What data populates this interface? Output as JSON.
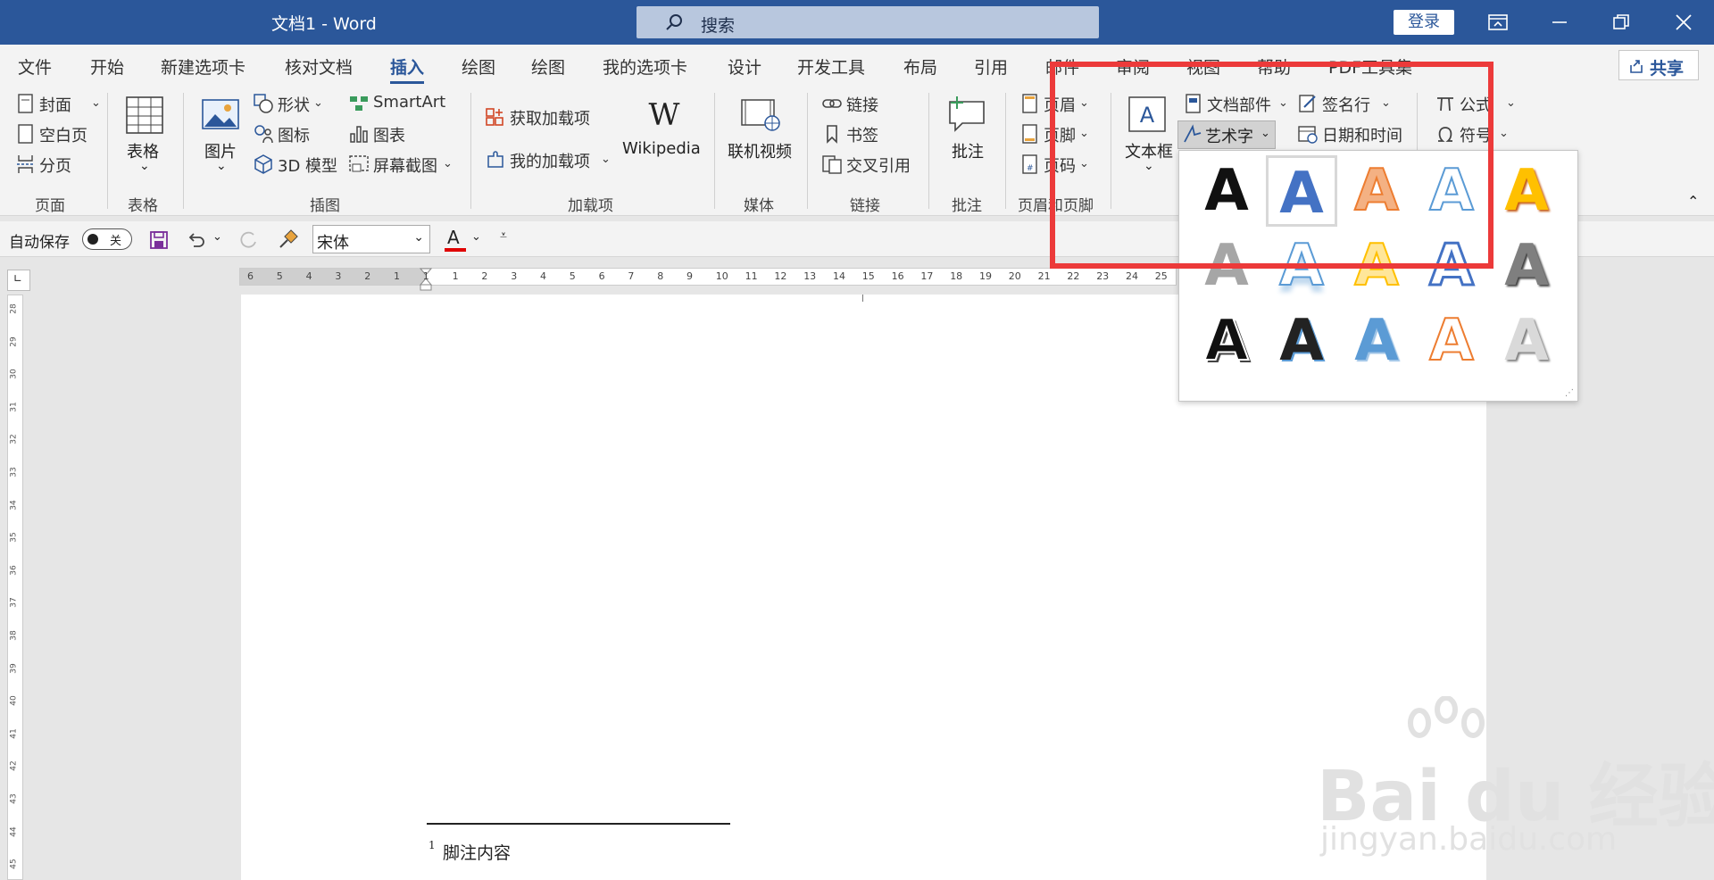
{
  "title_bar": {
    "doc_title": "文档1  -  Word",
    "search_placeholder": "搜索",
    "login_label": "登录",
    "accent_color": "#2b579a"
  },
  "tabs": [
    {
      "label": "文件"
    },
    {
      "label": "开始"
    },
    {
      "label": "新建选项卡"
    },
    {
      "label": "核对文档"
    },
    {
      "label": "插入",
      "active": true
    },
    {
      "label": "绘图"
    },
    {
      "label": "绘图"
    },
    {
      "label": "我的选项卡"
    },
    {
      "label": "设计"
    },
    {
      "label": "开发工具"
    },
    {
      "label": "布局"
    },
    {
      "label": "引用"
    },
    {
      "label": "邮件"
    },
    {
      "label": "审阅"
    },
    {
      "label": "视图"
    },
    {
      "label": "帮助"
    },
    {
      "label": "PDF工具集"
    }
  ],
  "share_label": "共享",
  "ribbon": {
    "pages": {
      "cover": "封面",
      "blank": "空白页",
      "break": "分页",
      "group": "页面"
    },
    "tables": {
      "table": "表格",
      "group": "表格"
    },
    "illustrations": {
      "picture": "图片",
      "shapes": "形状",
      "icons": "图标",
      "model3d": "3D 模型",
      "smartart": "SmartArt",
      "chart": "图表",
      "screenshot": "屏幕截图",
      "group": "插图"
    },
    "addins": {
      "get": "获取加载项",
      "my": "我的加载项",
      "wikipedia": "Wikipedia",
      "group": "加载项"
    },
    "media": {
      "video": "联机视频",
      "group": "媒体"
    },
    "links": {
      "link": "链接",
      "bookmark": "书签",
      "crossref": "交叉引用",
      "group": "链接"
    },
    "comments": {
      "comment": "批注",
      "group": "批注"
    },
    "header_footer": {
      "header": "页眉",
      "footer": "页脚",
      "page_number": "页码",
      "group": "页眉和页脚"
    },
    "text": {
      "textbox": "文本框",
      "quickparts": "文档部件",
      "wordart": "艺术字",
      "signature": "签名行",
      "datetime": "日期和时间"
    },
    "symbols": {
      "equation": "公式",
      "symbol": "符号"
    }
  },
  "qat": {
    "autosave_label": "自动保存",
    "toggle_state": "关",
    "font_name": "宋体",
    "font_color_letter": "A"
  },
  "ruler_h": [
    "6",
    "5",
    "4",
    "3",
    "2",
    "1",
    "1",
    "1",
    "2",
    "3",
    "4",
    "5",
    "6",
    "7",
    "8",
    "9",
    "10",
    "11",
    "12",
    "13",
    "14",
    "15",
    "16",
    "17",
    "18",
    "19",
    "20",
    "21",
    "22",
    "23",
    "24",
    "25"
  ],
  "ruler_v": [
    "28",
    "29",
    "30",
    "31",
    "32",
    "33",
    "34",
    "35",
    "36",
    "37",
    "38",
    "39",
    "40",
    "41",
    "42",
    "43",
    "44",
    "45"
  ],
  "wordart_gallery": [
    {
      "letter": "A",
      "style": "black-fill"
    },
    {
      "letter": "A",
      "style": "blue-fill-selected"
    },
    {
      "letter": "A",
      "style": "orange-gradient"
    },
    {
      "letter": "A",
      "style": "blue-outline"
    },
    {
      "letter": "A",
      "style": "gold-fill"
    },
    {
      "letter": "A",
      "style": "gray-fill"
    },
    {
      "letter": "A",
      "style": "blue-reflection"
    },
    {
      "letter": "A",
      "style": "gold-outline"
    },
    {
      "letter": "A",
      "style": "blue-outline-bold"
    },
    {
      "letter": "A",
      "style": "gray-dark"
    },
    {
      "letter": "A",
      "style": "black-shadow"
    },
    {
      "letter": "A",
      "style": "black-bevel"
    },
    {
      "letter": "A",
      "style": "blue-bevel"
    },
    {
      "letter": "A",
      "style": "orange-outline"
    },
    {
      "letter": "A",
      "style": "silver"
    }
  ],
  "footnote": {
    "number": "1",
    "text": "脚注内容"
  },
  "watermark": {
    "main": "Bai du 经验",
    "sub": "jingyan.baidu.com"
  },
  "highlight_color": "#ec3a3a"
}
